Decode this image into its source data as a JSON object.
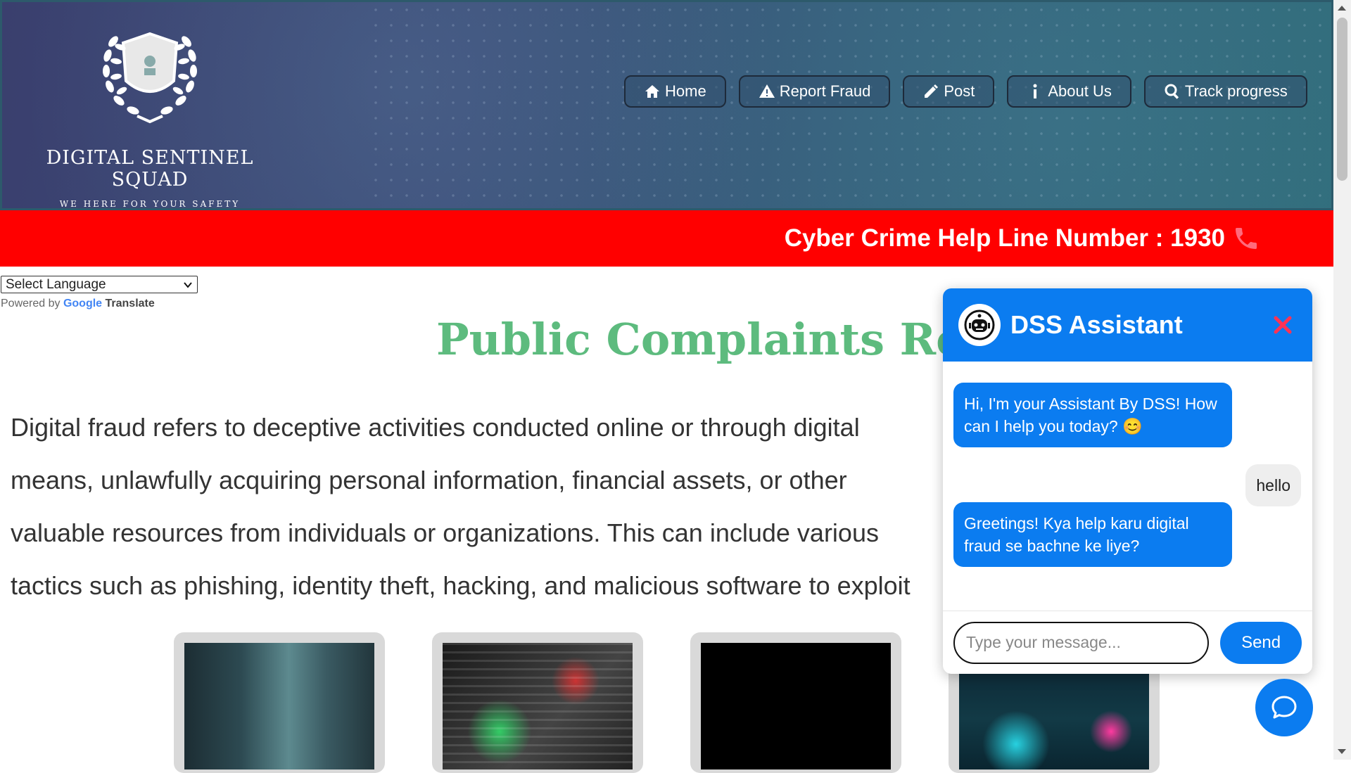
{
  "header": {
    "brand_name": "DIGITAL SENTINEL SQUAD",
    "tagline": "WE HERE FOR YOUR SAFETY",
    "nav": [
      {
        "label": "Home",
        "icon": "home-icon"
      },
      {
        "label": "Report Fraud",
        "icon": "warning-icon"
      },
      {
        "label": "Post",
        "icon": "pencil-icon"
      },
      {
        "label": "About Us",
        "icon": "info-icon"
      },
      {
        "label": "Track progress",
        "icon": "search-icon"
      }
    ]
  },
  "helpline": {
    "text": "Cyber Crime Help Line Number : 1930",
    "icon": "phone-icon"
  },
  "translate": {
    "select_value": "Select Language",
    "powered_by": "Powered by",
    "google": "Google",
    "translate": "Translate"
  },
  "main": {
    "title": "Public Complaints Re",
    "intro": "Digital fraud refers to deceptive activities conducted online or through digital means, unlawfully acquiring personal information, financial assets, or other valuable resources from individuals or organizations. This can include various tactics such as phishing, identity theft, hacking, and malicious software to exploit vulnerabilities and perpetrate fraudulent schemes."
  },
  "chat": {
    "title": "DSS Assistant",
    "messages": [
      {
        "from": "bot",
        "text": "Hi, I'm your Assistant By DSS! How can I help you today? 😊"
      },
      {
        "from": "user",
        "text": "hello"
      },
      {
        "from": "bot",
        "text": "Greetings! Kya help karu digital fraud se bachne ke liye?"
      }
    ],
    "input_placeholder": "Type your message...",
    "send_label": "Send"
  },
  "colors": {
    "accent": "#0b7cf0",
    "helpline_bg": "#ff0000",
    "title_green": "#5dbb7e"
  }
}
